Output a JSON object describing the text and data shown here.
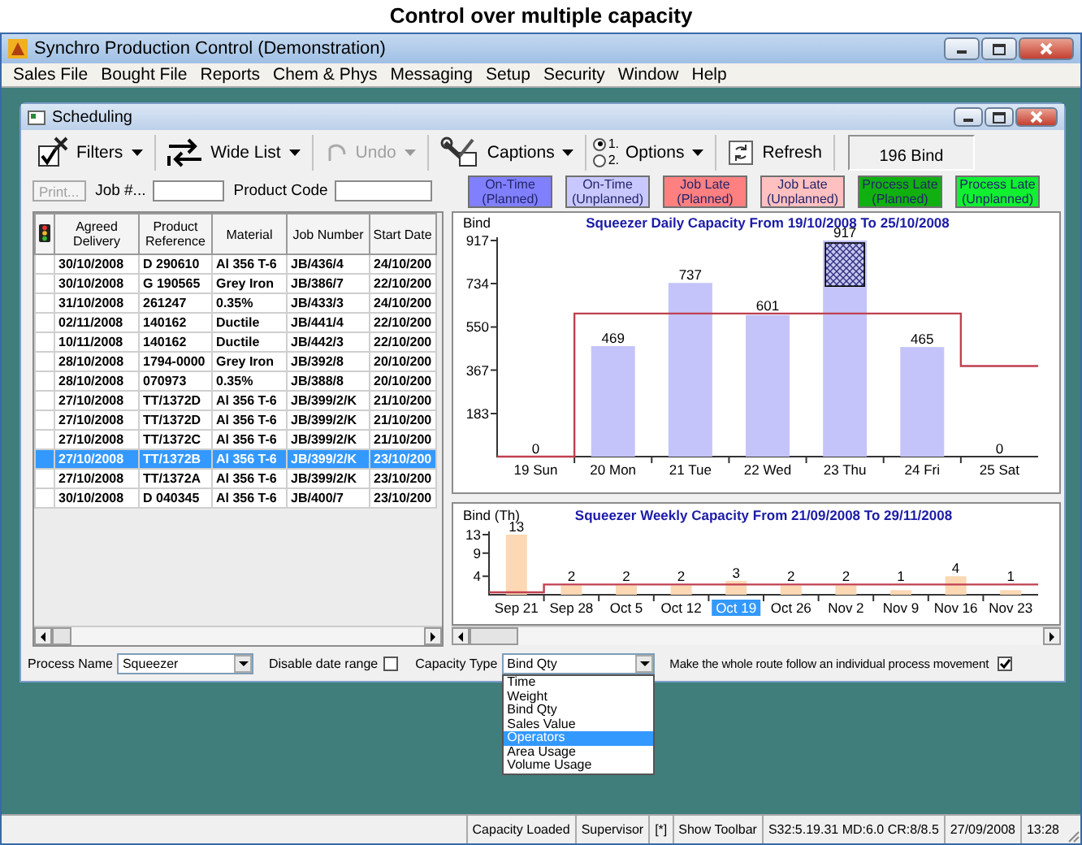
{
  "caption": "Control over multiple capacity",
  "app": {
    "title": "Synchro Production Control (Demonstration)"
  },
  "menu": [
    "Sales File",
    "Bought File",
    "Reports",
    "Chem & Phys",
    "Messaging",
    "Setup",
    "Security",
    "Window",
    "Help"
  ],
  "window": {
    "title": "Scheduling"
  },
  "toolbar": [
    {
      "kind": "filters",
      "label": "Filters",
      "dropdown": true,
      "disabled": false
    },
    {
      "kind": "wide_list",
      "label": "Wide List",
      "dropdown": true,
      "disabled": false
    },
    {
      "kind": "undo",
      "label": "Undo",
      "dropdown": true,
      "disabled": true
    },
    {
      "kind": "captions",
      "label": "Captions",
      "dropdown": true,
      "disabled": false
    },
    {
      "kind": "options",
      "label": "Options",
      "dropdown": true,
      "disabled": false
    },
    {
      "kind": "refresh",
      "label": "Refresh",
      "dropdown": false,
      "disabled": false
    }
  ],
  "options_radios": [
    {
      "label": "1.",
      "selected": true
    },
    {
      "label": "2.",
      "selected": false
    }
  ],
  "bind_count": "196 Bind",
  "filters": {
    "print_button": {
      "label": "Print...",
      "disabled": true
    },
    "job_label": "Job #...",
    "product_label": "Product Code"
  },
  "legend": [
    {
      "label": "On-Time\n(Planned)",
      "color": "#8080ff"
    },
    {
      "label": "On-Time\n(Unplanned)",
      "color": "#c8c8ff"
    },
    {
      "label": "Job Late\n(Planned)",
      "color": "#ff8080"
    },
    {
      "label": "Job Late\n(Unplanned)",
      "color": "#ffc0c0"
    },
    {
      "label": "Process Late\n(Planned)",
      "color": "#10b010"
    },
    {
      "label": "Process Late\n(Unplanned)",
      "color": "#10f030"
    }
  ],
  "table": {
    "columns": [
      "Agreed Delivery",
      "Product Reference",
      "Material",
      "Job Number",
      "Start Date"
    ],
    "rows": [
      {
        "cells": [
          "30/10/2008",
          "D 290610",
          "Al 356 T-6",
          "JB/436/4",
          "24/10/200"
        ],
        "selected": false
      },
      {
        "cells": [
          "30/10/2008",
          "G 190565",
          "Grey Iron",
          "JB/386/7",
          "22/10/200"
        ],
        "selected": false
      },
      {
        "cells": [
          "31/10/2008",
          "261247",
          "0.35%",
          "JB/433/3",
          "24/10/200"
        ],
        "selected": false
      },
      {
        "cells": [
          "02/11/2008",
          "140162",
          "Ductile",
          "JB/441/4",
          "22/10/200"
        ],
        "selected": false
      },
      {
        "cells": [
          "10/11/2008",
          "140162",
          "Ductile",
          "JB/442/3",
          "22/10/200"
        ],
        "selected": false
      },
      {
        "cells": [
          "28/10/2008",
          "1794-0000",
          "Grey Iron",
          "JB/392/8",
          "20/10/200"
        ],
        "selected": false
      },
      {
        "cells": [
          "28/10/2008",
          "070973",
          "0.35%",
          "JB/388/8",
          "20/10/200"
        ],
        "selected": false
      },
      {
        "cells": [
          "27/10/2008",
          "TT/1372D",
          "Al 356 T-6",
          "JB/399/2/K",
          "21/10/200"
        ],
        "selected": false
      },
      {
        "cells": [
          "27/10/2008",
          "TT/1372D",
          "Al 356 T-6",
          "JB/399/2/K",
          "21/10/200"
        ],
        "selected": false
      },
      {
        "cells": [
          "27/10/2008",
          "TT/1372C",
          "Al 356 T-6",
          "JB/399/2/K",
          "21/10/200"
        ],
        "selected": false
      },
      {
        "cells": [
          "27/10/2008",
          "TT/1372B",
          "Al 356 T-6",
          "JB/399/2/K",
          "23/10/200"
        ],
        "selected": true
      },
      {
        "cells": [
          "27/10/2008",
          "TT/1372A",
          "Al 356 T-6",
          "JB/399/2/K",
          "23/10/200"
        ],
        "selected": false
      },
      {
        "cells": [
          "30/10/2008",
          "D 040345",
          "Al 356 T-6",
          "JB/400/7",
          "23/10/200"
        ],
        "selected": false
      }
    ]
  },
  "daily_chart": {
    "chart_data": {
      "type": "bar",
      "title": "Squeezer Daily Capacity From 19/10/2008 To 25/10/2008",
      "ylabel": "Bind",
      "categories": [
        "19 Sun",
        "20 Mon",
        "21 Tue",
        "22 Wed",
        "23 Thu",
        "24 Fri",
        "25 Sat"
      ],
      "values": [
        0,
        469,
        737,
        601,
        917,
        465,
        0
      ],
      "ylim": [
        0,
        917
      ],
      "yticks": [
        183,
        367,
        550,
        734,
        917
      ],
      "data_labels": true
    }
  },
  "weekly_chart": {
    "chart_data": {
      "type": "bar",
      "title": "Squeezer Weekly Capacity From 21/09/2008 To 29/11/2008",
      "ylabel": "Bind (Th)",
      "categories": [
        "Sep 21",
        "Sep 28",
        "Oct 5",
        "Oct 12",
        "Oct 19",
        "Oct 26",
        "Nov 2",
        "Nov 9",
        "Nov 16",
        "Nov 23"
      ],
      "values": [
        13,
        2,
        2,
        2,
        3,
        2,
        2,
        1,
        4,
        1
      ],
      "ylim": [
        0,
        13
      ],
      "yticks": [
        4,
        9,
        13
      ],
      "data_labels": true
    },
    "category_selected": [
      false,
      false,
      false,
      false,
      true,
      false,
      false,
      false,
      false,
      false
    ]
  },
  "bottom": {
    "process_name": {
      "label": "Process Name",
      "value": "Squeezer"
    },
    "disable_date_range": {
      "label": "Disable date range",
      "checked": false
    },
    "capacity_type": {
      "label": "Capacity Type",
      "value": "Bind Qty",
      "expanded": true,
      "options": [
        {
          "label": "Time",
          "highlighted": false
        },
        {
          "label": "Weight",
          "highlighted": false
        },
        {
          "label": "Bind Qty",
          "highlighted": false
        },
        {
          "label": "Sales Value",
          "highlighted": false
        },
        {
          "label": "Operators",
          "highlighted": true
        },
        {
          "label": "Area Usage",
          "highlighted": false
        },
        {
          "label": "Volume Usage",
          "highlighted": false
        }
      ]
    },
    "whole_route": {
      "label": "Make the whole route follow an individual process movement",
      "checked": true
    }
  },
  "status_bar": [
    "Capacity Loaded",
    "Supervisor",
    "[*]",
    "Show Toolbar",
    "S32:5.19.31 MD:6.0 CR:8/8.5",
    "27/09/2008",
    "13:28"
  ]
}
